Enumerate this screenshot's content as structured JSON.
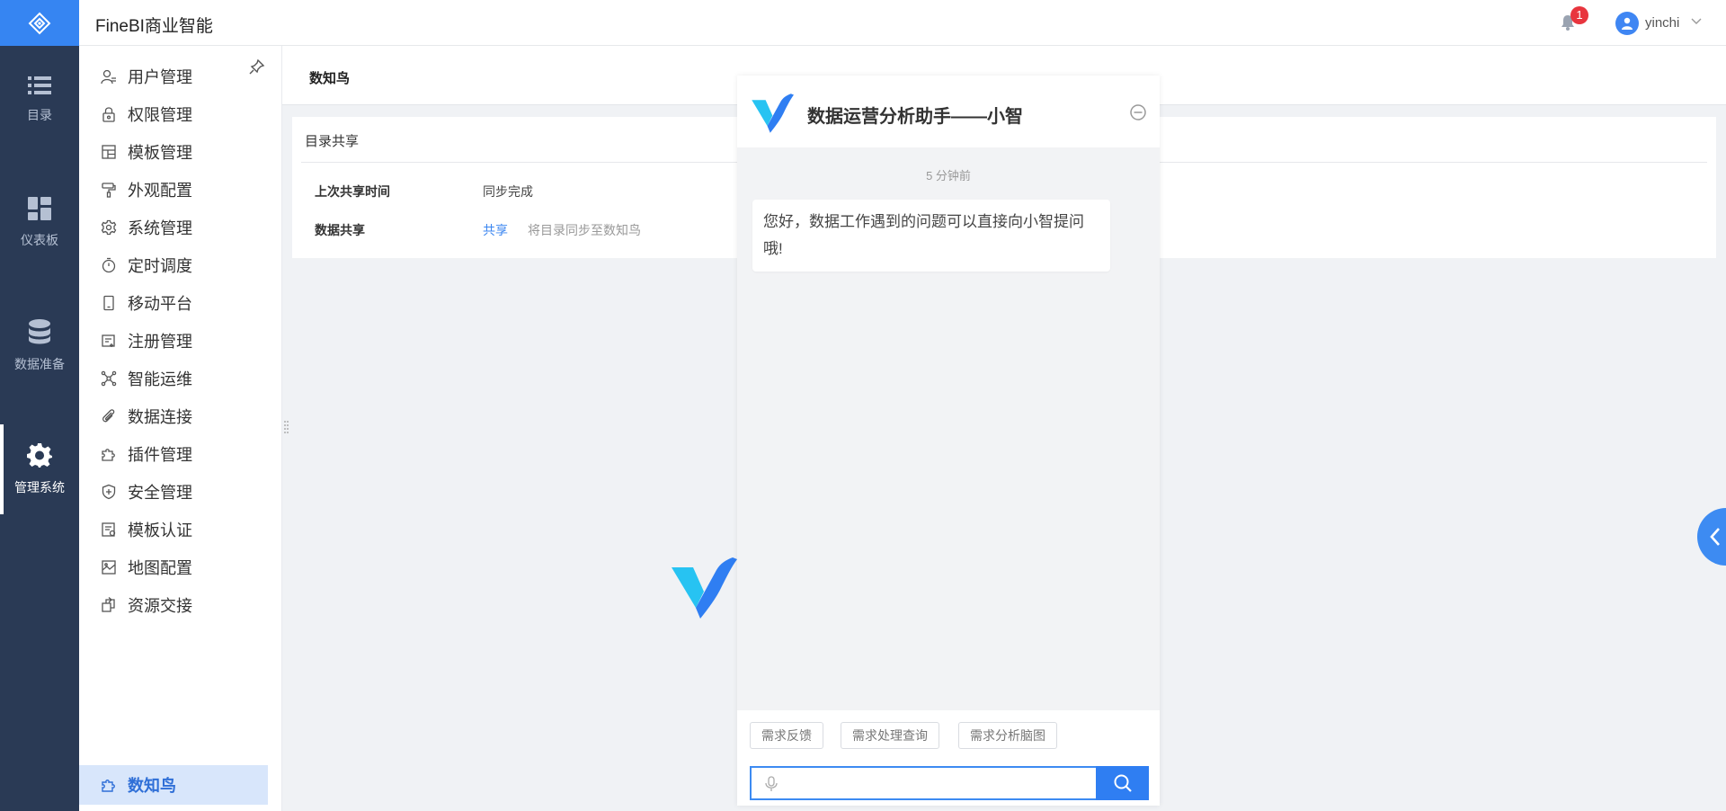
{
  "app": {
    "title": "FineBI商业智能"
  },
  "header": {
    "notification_count": "1",
    "username": "yinchi"
  },
  "rail": {
    "items": [
      {
        "label": "目录",
        "icon": "list-icon"
      },
      {
        "label": "仪表板",
        "icon": "dashboard-icon"
      },
      {
        "label": "数据准备",
        "icon": "database-icon"
      },
      {
        "label": "管理系统",
        "icon": "gear-icon",
        "active": true
      }
    ]
  },
  "sidebar": {
    "items": [
      {
        "label": "用户管理",
        "icon": "user-icon"
      },
      {
        "label": "权限管理",
        "icon": "lock-icon"
      },
      {
        "label": "模板管理",
        "icon": "template-icon"
      },
      {
        "label": "外观配置",
        "icon": "paint-roller-icon"
      },
      {
        "label": "系统管理",
        "icon": "gear-icon"
      },
      {
        "label": "定时调度",
        "icon": "timer-icon"
      },
      {
        "label": "移动平台",
        "icon": "mobile-icon"
      },
      {
        "label": "注册管理",
        "icon": "register-icon"
      },
      {
        "label": "智能运维",
        "icon": "network-icon"
      },
      {
        "label": "数据连接",
        "icon": "paperclip-icon"
      },
      {
        "label": "插件管理",
        "icon": "puzzle-icon"
      },
      {
        "label": "安全管理",
        "icon": "shield-icon"
      },
      {
        "label": "模板认证",
        "icon": "certificate-icon"
      },
      {
        "label": "地图配置",
        "icon": "map-icon"
      },
      {
        "label": "资源交接",
        "icon": "handover-icon"
      },
      {
        "label": "数知鸟",
        "icon": "puzzle-icon",
        "active": true
      }
    ]
  },
  "main": {
    "title": "数知鸟",
    "card": {
      "title": "目录共享",
      "rows": [
        {
          "label": "上次共享时间",
          "value": "同步完成"
        },
        {
          "label": "数据共享",
          "link": "共享",
          "hint": "将目录同步至数知鸟"
        }
      ]
    }
  },
  "chat": {
    "title": "数据运营分析助手——小智",
    "time": "5 分钟前",
    "message": "您好，数据工作遇到的问题可以直接向小智提问哦!",
    "quick_replies": [
      "需求反馈",
      "需求处理查询",
      "需求分析脑图"
    ],
    "input_placeholder": ""
  },
  "colors": {
    "accent": "#3685f2",
    "rail_bg": "#2a3a55",
    "active_bg": "#d8e6fb"
  }
}
